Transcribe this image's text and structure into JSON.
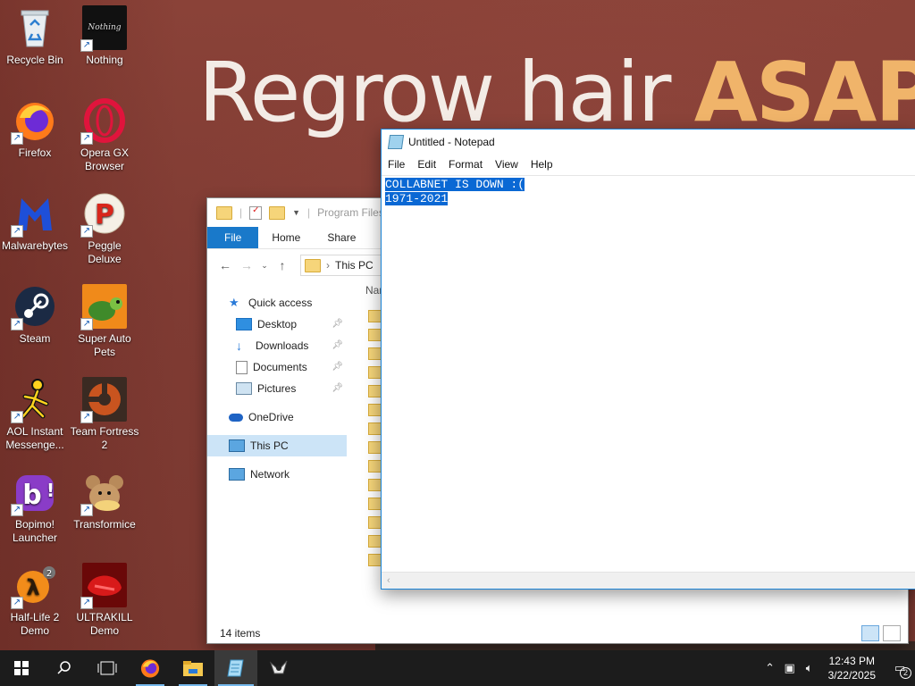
{
  "wallpaper": {
    "headline": "Regrow hair",
    "headline_accent": "ASAP"
  },
  "desktop": {
    "icons": [
      {
        "label": "Recycle Bin",
        "icon": "recycle-bin-icon"
      },
      {
        "label": "Nothing",
        "icon": "nothing-icon"
      },
      {
        "label": "Firefox",
        "icon": "firefox-icon"
      },
      {
        "label": "Opera GX Browser",
        "icon": "opera-gx-icon"
      },
      {
        "label": "Malwarebytes",
        "icon": "malwarebytes-icon"
      },
      {
        "label": "Peggle Deluxe",
        "icon": "peggle-icon"
      },
      {
        "label": "Steam",
        "icon": "steam-icon"
      },
      {
        "label": "Super Auto Pets",
        "icon": "super-auto-pets-icon"
      },
      {
        "label": "AOL Instant Messenge...",
        "icon": "aol-instant-messenger-icon"
      },
      {
        "label": "Team Fortress 2",
        "icon": "team-fortress-2-icon"
      },
      {
        "label": "Bopimo! Launcher",
        "icon": "bopimo-icon"
      },
      {
        "label": "Transformice",
        "icon": "transformice-icon"
      },
      {
        "label": "Half-Life 2 Demo",
        "icon": "half-life-2-icon"
      },
      {
        "label": "ULTRAKILL Demo",
        "icon": "ultrakill-icon"
      }
    ],
    "nothing_icon_text": "Nothing"
  },
  "explorer": {
    "path_title": "Program Files (x",
    "ribbon_tabs": [
      "File",
      "Home",
      "Share",
      "V"
    ],
    "address": "This PC",
    "column_header": "Nar",
    "nav": [
      {
        "label": "Quick access",
        "pinned": false
      },
      {
        "label": "Desktop",
        "pinned": true
      },
      {
        "label": "Downloads",
        "pinned": true
      },
      {
        "label": "Documents",
        "pinned": true
      },
      {
        "label": "Pictures",
        "pinned": true
      },
      {
        "label": "OneDrive",
        "pinned": false
      },
      {
        "label": "This PC",
        "pinned": false
      },
      {
        "label": "Network",
        "pinned": false
      }
    ],
    "status": "14 items"
  },
  "notepad": {
    "title": "Untitled - Notepad",
    "menu": [
      "File",
      "Edit",
      "Format",
      "View",
      "Help"
    ],
    "lines": [
      "COLLABNET IS DOWN :(",
      "1971-2021"
    ]
  },
  "taskbar": {
    "clock_time": "12:43 PM",
    "clock_date": "3/22/2025",
    "notification_count": "2",
    "colors": {
      "accent": "#76b9ed",
      "bar": "#1c1c1c"
    }
  }
}
